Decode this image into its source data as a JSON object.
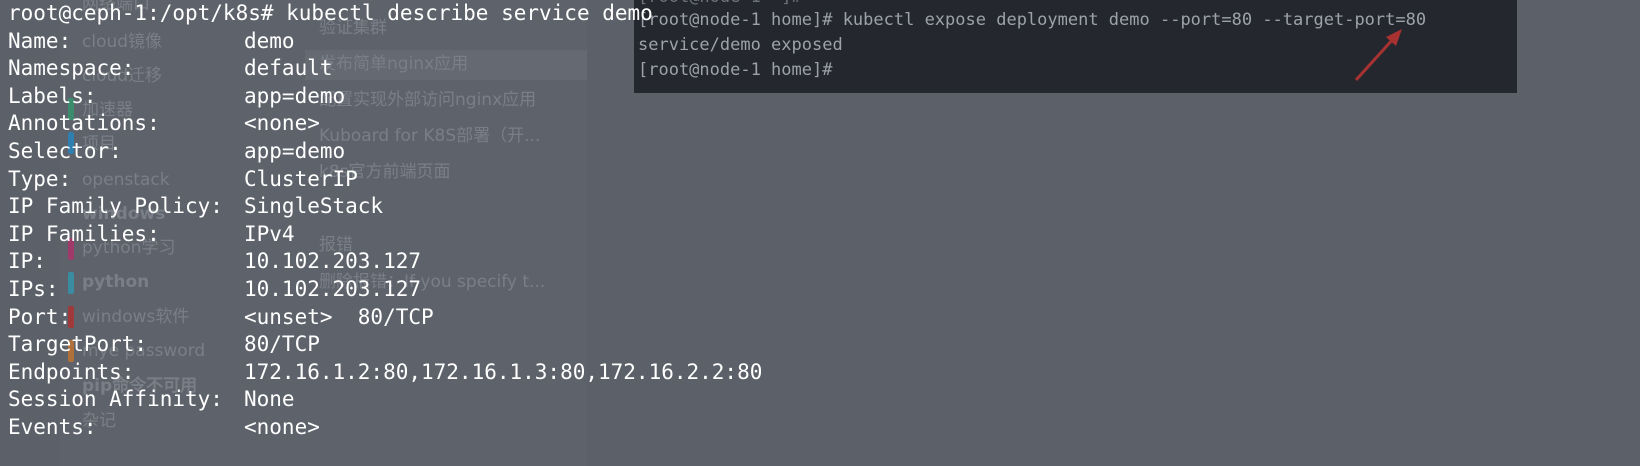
{
  "background_app": {
    "sidebar_items": [
      {
        "label": "网络端口",
        "bold": false
      },
      {
        "label": "cloud镜像",
        "bold": false
      },
      {
        "label": "cloud迁移",
        "bold": false
      },
      {
        "label": "加速器",
        "bold": false
      },
      {
        "label": "项目",
        "bold": false
      },
      {
        "label": "openstack",
        "bold": false
      },
      {
        "label": "windows",
        "bold": true
      },
      {
        "label": "python学习",
        "bold": false
      },
      {
        "label": "python",
        "bold": true
      },
      {
        "label": "windows软件",
        "bold": false
      },
      {
        "label": "mye password",
        "bold": false
      },
      {
        "label": "pip命令不可用",
        "bold": false
      },
      {
        "label": "杂记",
        "bold": false
      }
    ],
    "note_items": [
      "验证集群",
      "发布简单nginx应用",
      "配置实现外部访问nginx应用",
      "Kuboard for K8S部署（开...",
      "k8s官方前端页面",
      "报错",
      "删除报错：If you specify t..."
    ]
  },
  "terminal": {
    "prompt_line": "root@ceph-1:/opt/k8s# kubectl describe service demo",
    "fields": [
      {
        "key": "Name:",
        "value": "demo"
      },
      {
        "key": "Namespace:",
        "value": "default"
      },
      {
        "key": "Labels:",
        "value": "app=demo"
      },
      {
        "key": "Annotations:",
        "value": "<none>"
      },
      {
        "key": "Selector:",
        "value": "app=demo"
      },
      {
        "key": "Type:",
        "value": "ClusterIP"
      },
      {
        "key": "IP Family Policy:",
        "value": "SingleStack"
      },
      {
        "key": "IP Families:",
        "value": "IPv4"
      },
      {
        "key": "IP:",
        "value": "10.102.203.127"
      },
      {
        "key": "IPs:",
        "value": "10.102.203.127"
      },
      {
        "key": "Port:",
        "value": "<unset>  80/TCP"
      },
      {
        "key": "TargetPort:",
        "value": "80/TCP"
      },
      {
        "key": "Endpoints:",
        "value": "172.16.1.2:80,172.16.1.3:80,172.16.2.2:80"
      },
      {
        "key": "Session Affinity:",
        "value": "None"
      },
      {
        "key": "Events:",
        "value": "<none>"
      }
    ]
  },
  "inset_terminal": {
    "lines": [
      "[root@node-1 home]# kubectl expose deployment demo --port=80 --target-port=80",
      "service/demo exposed",
      "[root@node-1 home]#"
    ],
    "arrow_color": "#b03030"
  }
}
